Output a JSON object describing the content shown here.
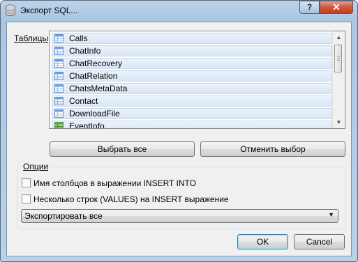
{
  "window": {
    "title": "Экспорт SQL...",
    "help_label": "?",
    "close_label": "✕"
  },
  "tables": {
    "label": "Таблицы",
    "items": [
      {
        "label": "Calls",
        "icon": "table-icon"
      },
      {
        "label": "ChatInfo",
        "icon": "table-icon"
      },
      {
        "label": "ChatRecovery",
        "icon": "table-icon"
      },
      {
        "label": "ChatRelation",
        "icon": "table-icon"
      },
      {
        "label": "ChatsMetaData",
        "icon": "table-icon"
      },
      {
        "label": "Contact",
        "icon": "table-icon"
      },
      {
        "label": "DownloadFile",
        "icon": "table-icon"
      },
      {
        "label": "EventInfo",
        "icon": "view-icon"
      }
    ]
  },
  "buttons": {
    "select_all": "Выбрать все",
    "deselect": "Отменить выбор",
    "ok": "OK",
    "cancel": "Cancel"
  },
  "options": {
    "label": "Опции",
    "column_names": "Имя столбцов в выражении INSERT INTO",
    "multi_rows": "Несколько строк (VALUES) на INSERT выражение",
    "export_mode": "Экспортировать все"
  },
  "colors": {
    "title_bar": "#a9c6e3",
    "close_button": "#c2401f",
    "list_item": "#dbe7f5",
    "dialog_bg": "#f0f0f0"
  }
}
